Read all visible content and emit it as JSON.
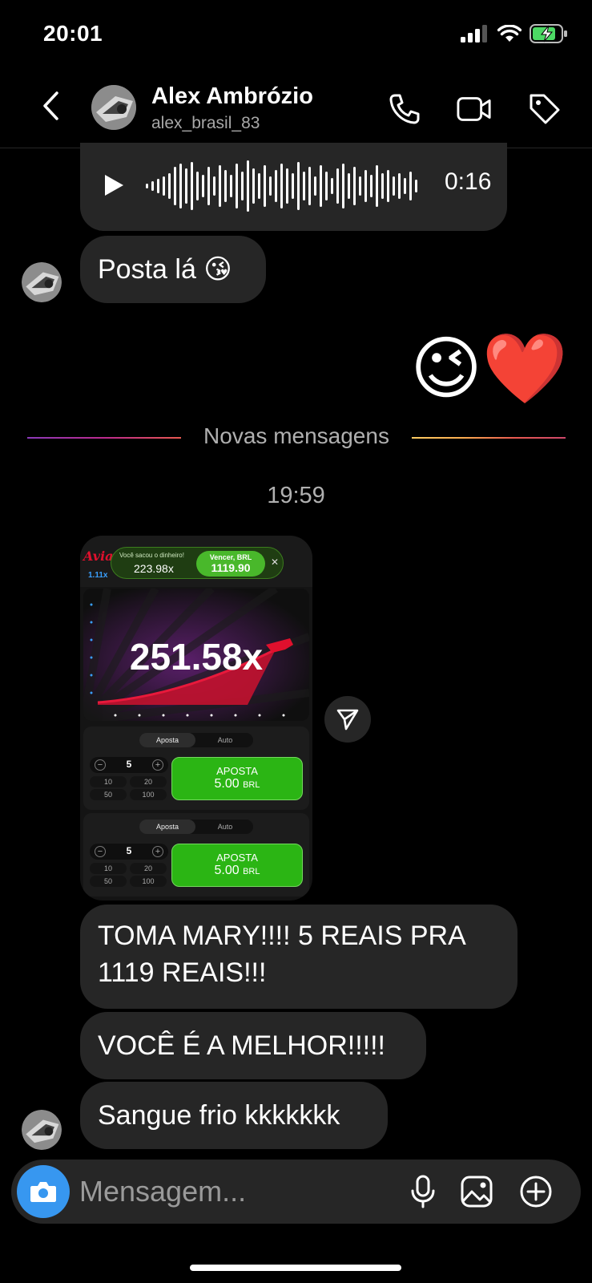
{
  "status_bar": {
    "time": "20:01",
    "icons": [
      "signal-icon",
      "wifi-icon",
      "battery-charging-icon"
    ]
  },
  "header": {
    "contact_name": "Alex Ambrózio",
    "contact_handle": "alex_brasil_83",
    "icons": [
      "back-chevron-icon",
      "phone-icon",
      "video-camera-icon",
      "tag-icon"
    ]
  },
  "messages": {
    "voice_duration": "0:16",
    "posta_la": "Posta lá 😘",
    "reaction_emojis": "😉❤️",
    "new_messages_label": "Novas mensagens",
    "timestamp": "19:59",
    "msg_toma": "TOMA MARY!!!! 5 REAIS PRA 1119 REAIS!!!",
    "msg_voce": "VOCÊ É A MELHOR!!!!!",
    "msg_sangue": "Sangue frio kkkkkkk"
  },
  "shared_image": {
    "logo": "Aviator",
    "cashout_label": "Você sacou o dinheiro!",
    "cashout_multiplier": "223.98x",
    "win_label": "Vencer, BRL",
    "win_value": "1119.90",
    "small_multiplier": "1.11x",
    "big_multiplier": "251.58x",
    "tab_bet": "Aposta",
    "tab_auto": "Auto",
    "stake": "5",
    "quick_amounts": [
      "10",
      "20",
      "50",
      "100"
    ],
    "bet_button_label": "APOSTA",
    "bet_button_amount": "5.00",
    "bet_currency": "BRL"
  },
  "composer": {
    "placeholder": "Mensagem...",
    "icons": [
      "camera-icon",
      "microphone-icon",
      "gallery-icon",
      "add-circle-icon"
    ]
  },
  "colors": {
    "background": "#000000",
    "bubble": "#262626",
    "camera_blue": "#3797f0",
    "bet_green": "#2bb514"
  }
}
